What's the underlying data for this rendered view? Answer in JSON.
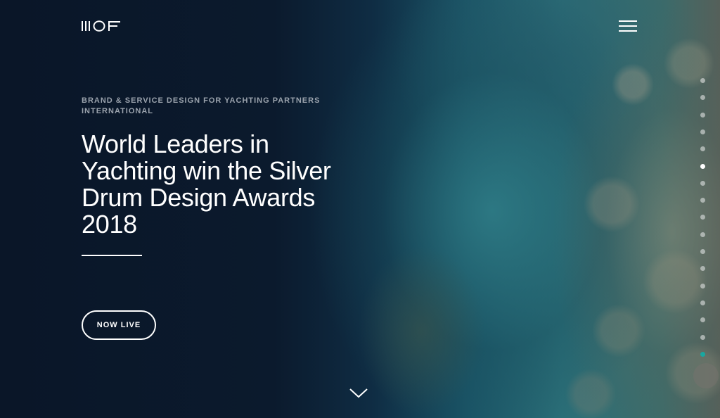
{
  "brand": {
    "logo_text": "IIIOF",
    "logo_icon": "mof-logo-icon"
  },
  "header": {
    "menu_icon": "hamburger-menu-icon"
  },
  "hero": {
    "eyebrow": "BRAND & SERVICE DESIGN FOR YACHTING PARTNERS INTERNATIONAL",
    "headline": "World Leaders in Yachting win the Silver Drum Design Awards 2018",
    "cta_label": "NOW LIVE",
    "scroll_icon": "chevron-down-icon"
  },
  "pagination": {
    "total": 17,
    "active_index": 5,
    "highlight_index": 16,
    "colors": {
      "active": "#ffffff",
      "highlight": "#19a7a0",
      "inactive": "#cdd2d0"
    }
  }
}
